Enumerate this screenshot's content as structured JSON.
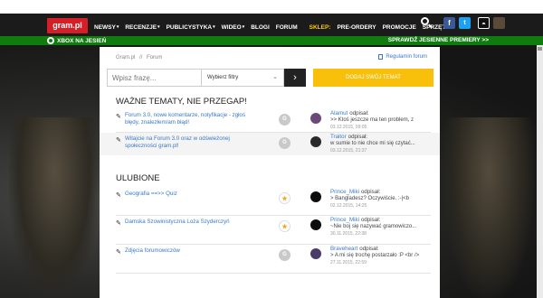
{
  "topbar": {
    "logo": "gram.pl",
    "nav": [
      {
        "label": "NEWSY",
        "caret": true
      },
      {
        "label": "RECENZJE",
        "caret": true
      },
      {
        "label": "PUBLICYSTYKA",
        "caret": true
      },
      {
        "label": "WIDEO",
        "caret": true
      },
      {
        "label": "BLOGI",
        "caret": false
      },
      {
        "label": "FORUM",
        "caret": false
      }
    ],
    "shop_label": "SKLEP:",
    "shop_nav": [
      "PRE-ORDERY",
      "PROMOCJE",
      "SPRZĘT"
    ],
    "fb": "f",
    "tw": "t"
  },
  "promo": {
    "left": "XBOX NA JESIEŃ",
    "right": "SPRAWDŹ JESIENNE PREMIERY >>"
  },
  "forum": {
    "breadcrumb": [
      "Gram.pl",
      "//",
      "Forum"
    ],
    "rules_link": "Regulamin forum",
    "search_placeholder": "Wpisz frazę...",
    "filter_label": "Wybierz filtry",
    "go_symbol": "›",
    "add_topic": "DODAJ SWÓJ TEMAT",
    "important_title": "WAŻNE TEMATY, NIE PRZEGAP!",
    "favorites_title": "ULUBIONE",
    "important": [
      {
        "title": "Forum 3.0, nowe komentarze, notyfikacje - zgłoś błędy, znalezłem/am błąd!",
        "badge": "G",
        "user": "Alamut",
        "verb": "odpisał:",
        "msg": ">> Ktoś jeszcze ma ten problem, z",
        "time": "03.12.2015, 09:05",
        "avatar": "#6b4a7a"
      },
      {
        "title": "Witajcie na Forum 3.0 oraz w odświeżonej społeczności gram.pl!",
        "badge": "G",
        "user": "Traitor",
        "verb": "odpisał:",
        "msg": "w sumie to nie chce mi się czytać...",
        "time": "03.12.2015, 21:37",
        "avatar": "#2a2a2a"
      }
    ],
    "favorites": [
      {
        "title": "Geografia ==>> Quiz",
        "badge": "★",
        "user": "Prince_Miki",
        "verb": "odpisał:",
        "msg": "> Bangladesz? Oczywiście. :-|<b",
        "time": "02.12.2015, 14:25",
        "avatar": "#0d0d0d"
      },
      {
        "title": "Damska Szowinistyczna Loża Szyderczyń",
        "badge": "★",
        "user": "Prince_Miki",
        "verb": "odpisał:",
        "msg": "~Nie boj się nazywać gramowiczo...",
        "time": "30.11.2015, 22:38",
        "avatar": "#0d0d0d"
      },
      {
        "title": "Zdjęcia forumowiczów",
        "badge": "G",
        "user": "Braveheart",
        "verb": "odpisał:",
        "msg": "> A mi się trochę postarzało :P <br />",
        "time": "27.11.2015, 22:59",
        "avatar": "#4a3a6a"
      }
    ]
  }
}
